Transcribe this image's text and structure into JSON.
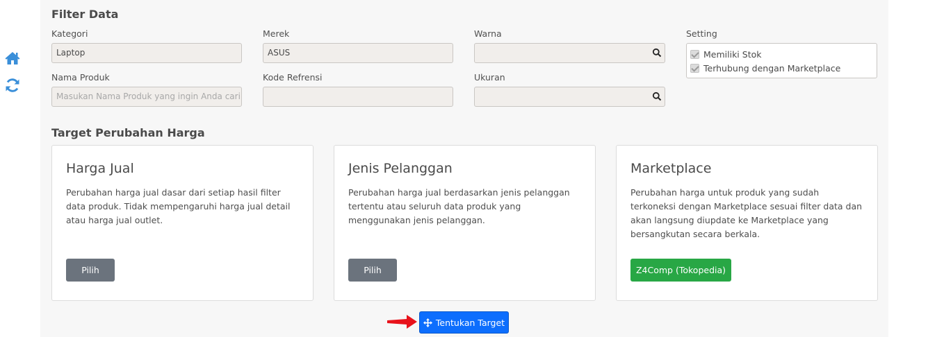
{
  "filter": {
    "title": "Filter Data",
    "kategori": {
      "label": "Kategori",
      "value": "Laptop"
    },
    "merek": {
      "label": "Merek",
      "value": "ASUS"
    },
    "warna": {
      "label": "Warna",
      "value": ""
    },
    "setting": {
      "label": "Setting",
      "options": [
        {
          "label": "Memiliki Stok",
          "checked": true
        },
        {
          "label": "Terhubung dengan Marketplace",
          "checked": true
        }
      ]
    },
    "nama_produk": {
      "label": "Nama Produk",
      "placeholder": "Masukan Nama Produk yang ingin Anda cari"
    },
    "kode_refrensi": {
      "label": "Kode Refrensi",
      "value": ""
    },
    "ukuran": {
      "label": "Ukuran",
      "value": ""
    }
  },
  "target": {
    "title": "Target Perubahan Harga",
    "cards": [
      {
        "title": "Harga Jual",
        "description": "Perubahan harga jual dasar dari setiap hasil filter data produk. Tidak mempengaruhi harga jual detail atau harga jual outlet.",
        "button": "Pilih"
      },
      {
        "title": "Jenis Pelanggan",
        "description": "Perubahan harga jual berdasarkan jenis pelanggan tertentu atau seluruh data produk yang menggunakan jenis pelanggan.",
        "button": "Pilih"
      },
      {
        "title": "Marketplace",
        "description": "Perubahan harga untuk produk yang sudah terkoneksi dengan Marketplace sesuai filter data dan akan langsung diupdate ke Marketplace yang bersangkutan secara berkala.",
        "button": "Z4Comp (Tokopedia)"
      }
    ],
    "submit_label": "Tentukan Target"
  },
  "sidebar": {
    "icons": [
      "home-icon",
      "refresh-icon"
    ]
  },
  "colors": {
    "accent": "#0d6efd",
    "success": "#28a745",
    "secondary": "#6b737d",
    "sidebar_icon": "#3a8fd9",
    "arrow": "#e8121b"
  }
}
